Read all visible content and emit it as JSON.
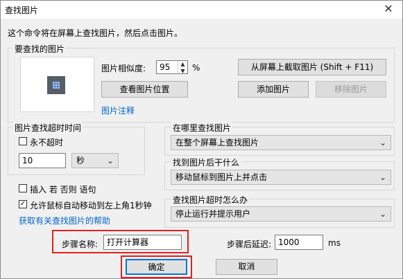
{
  "window": {
    "title": "查找图片",
    "close_glyph": "✕"
  },
  "instruction": "这个命令将在屏幕上查找图片，然后点击图片。",
  "image_group": {
    "label": "要查找的图片",
    "similarity_label": "图片相似度:",
    "similarity_value": "95",
    "percent": "%",
    "capture_button": "从屏幕上截取图片 (Shift + F11)",
    "view_position_button": "查看图片位置",
    "add_button": "添加图片",
    "remove_button": "移除图片",
    "annotation_link": "图片注释"
  },
  "timeout_group": {
    "label": "图片查找超时时间",
    "never_timeout_label": "永不超时",
    "never_timeout_checked": false,
    "timeout_value": "10",
    "unit_selected": "秒"
  },
  "where_group": {
    "label": "在哪里查找图片",
    "selected": "在整个屏幕上查找图片"
  },
  "after_find_group": {
    "label": "找到图片后干什么",
    "selected": "移动鼠标到图片上并点击"
  },
  "timeout_action_group": {
    "label": "查找图片超时怎么办",
    "selected": "停止运行并提示用户"
  },
  "options": {
    "insert_if_else_label": "插入 若 否则 语句",
    "insert_if_else_checked": false,
    "allow_mouse_label": "允许鼠标自动移动到左上角1秒钟",
    "allow_mouse_checked": true,
    "help_link": "获取有关查找图片的帮助"
  },
  "step": {
    "name_label": "步骤名称:",
    "name_value": "打开计算器",
    "delay_label": "步骤后延迟:",
    "delay_value": "1000",
    "delay_unit": "ms"
  },
  "buttons": {
    "ok": "确定",
    "cancel": "取消"
  },
  "colors": {
    "highlight": "#e02020",
    "link": "#0066cc"
  },
  "icons": {
    "checkbox_check": "✓",
    "dropdown_arrow": "⌄",
    "spin_up": "▲",
    "spin_down": "▼"
  }
}
